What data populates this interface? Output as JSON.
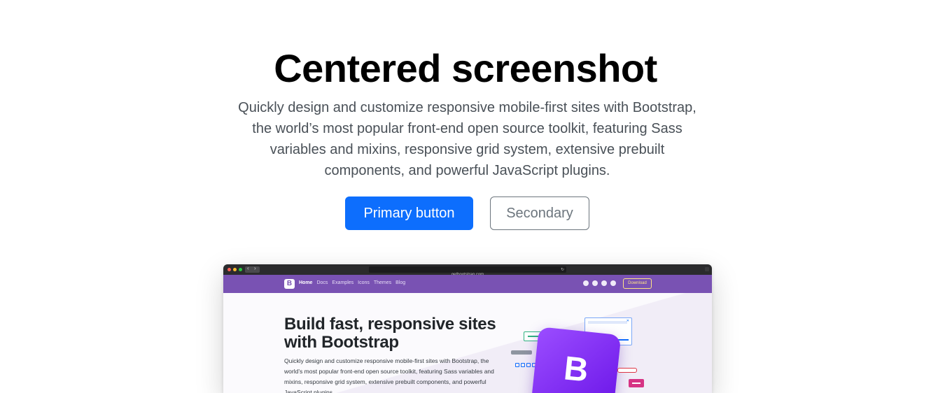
{
  "hero": {
    "title": "Centered screenshot",
    "lead": "Quickly design and customize responsive mobile-first sites with Bootstrap, the world’s most popular front-end open source toolkit, featuring Sass variables and mixins, responsive grid system, extensive prebuilt components, and powerful JavaScript plugins.",
    "primary_button": "Primary button",
    "secondary_button": "Secondary",
    "colors": {
      "primary": "#0d6efd",
      "secondary": "#6c757d"
    }
  },
  "screenshot": {
    "url": "getbootstrap.com",
    "nav": {
      "logo": "B",
      "links": [
        "Home",
        "Docs",
        "Examples",
        "Icons",
        "Themes",
        "Blog"
      ],
      "active_link": "Home",
      "icons": [
        "github-icon",
        "twitter-icon",
        "opencollective-icon",
        "theme-toggle-icon"
      ],
      "download": "Download",
      "brand_color": "#7952b3"
    },
    "heading": "Build fast, responsive sites with Bootstrap",
    "lead": "Quickly design and customize responsive mobile-first sites with Bootstrap, the world’s most popular front-end open source toolkit, featuring Sass variables and mixins, responsive grid system, extensive prebuilt components, and powerful JavaScript plugins.",
    "illustration_letter": "B"
  }
}
